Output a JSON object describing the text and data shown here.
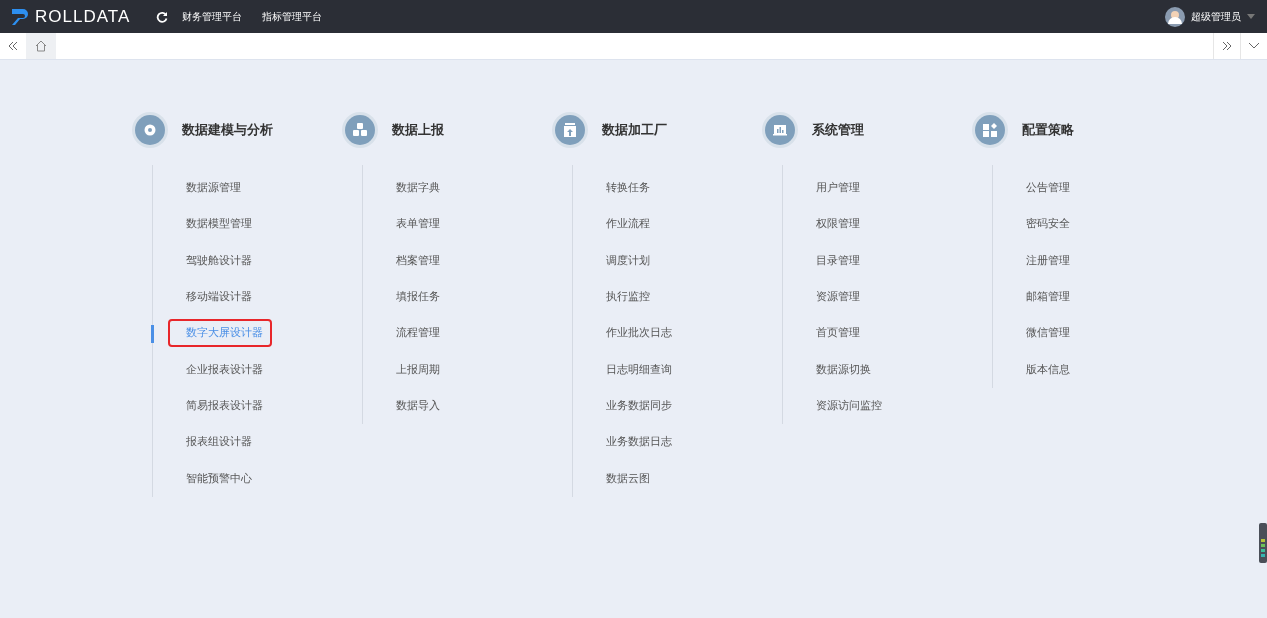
{
  "topbar": {
    "brand": "ROLLDATA",
    "nav": [
      {
        "label": "财务管理平台"
      },
      {
        "label": "指标管理平台"
      }
    ],
    "user": "超级管理员"
  },
  "groups": [
    {
      "title": "数据建模与分析",
      "kind": "gear",
      "items": [
        {
          "label": "数据源管理",
          "selected": false
        },
        {
          "label": "数据模型管理",
          "selected": false
        },
        {
          "label": "驾驶舱设计器",
          "selected": false
        },
        {
          "label": "移动端设计器",
          "selected": false
        },
        {
          "label": "数字大屏设计器",
          "selected": true
        },
        {
          "label": "企业报表设计器",
          "selected": false
        },
        {
          "label": "简易报表设计器",
          "selected": false
        },
        {
          "label": "报表组设计器",
          "selected": false
        },
        {
          "label": "智能预警中心",
          "selected": false
        }
      ]
    },
    {
      "title": "数据上报",
      "kind": "cubes",
      "items": [
        {
          "label": "数据字典",
          "selected": false
        },
        {
          "label": "表单管理",
          "selected": false
        },
        {
          "label": "档案管理",
          "selected": false
        },
        {
          "label": "填报任务",
          "selected": false
        },
        {
          "label": "流程管理",
          "selected": false
        },
        {
          "label": "上报周期",
          "selected": false
        },
        {
          "label": "数据导入",
          "selected": false
        }
      ]
    },
    {
      "title": "数据加工厂",
      "kind": "upload",
      "items": [
        {
          "label": "转换任务",
          "selected": false
        },
        {
          "label": "作业流程",
          "selected": false
        },
        {
          "label": "调度计划",
          "selected": false
        },
        {
          "label": "执行监控",
          "selected": false
        },
        {
          "label": "作业批次日志",
          "selected": false
        },
        {
          "label": "日志明细查询",
          "selected": false
        },
        {
          "label": "业务数据同步",
          "selected": false
        },
        {
          "label": "业务数据日志",
          "selected": false
        },
        {
          "label": "数据云图",
          "selected": false
        }
      ]
    },
    {
      "title": "系统管理",
      "kind": "screen",
      "items": [
        {
          "label": "用户管理",
          "selected": false
        },
        {
          "label": "权限管理",
          "selected": false
        },
        {
          "label": "目录管理",
          "selected": false
        },
        {
          "label": "资源管理",
          "selected": false
        },
        {
          "label": "首页管理",
          "selected": false
        },
        {
          "label": "数据源切换",
          "selected": false
        },
        {
          "label": "资源访问监控",
          "selected": false
        }
      ]
    },
    {
      "title": "配置策略",
      "kind": "tiles",
      "items": [
        {
          "label": "公告管理",
          "selected": false
        },
        {
          "label": "密码安全",
          "selected": false
        },
        {
          "label": "注册管理",
          "selected": false
        },
        {
          "label": "邮箱管理",
          "selected": false
        },
        {
          "label": "微信管理",
          "selected": false
        },
        {
          "label": "版本信息",
          "selected": false
        }
      ]
    }
  ]
}
